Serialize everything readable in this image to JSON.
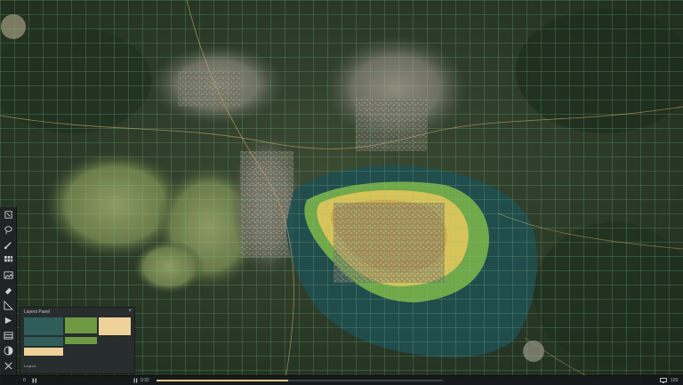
{
  "layers_panel": {
    "title": "Layers Panel",
    "close_glyph": "×",
    "swatches": [
      {
        "color": "#2f5e5a"
      },
      {
        "color": "#6f9a44"
      },
      {
        "color": "#efd19a"
      },
      {
        "color": "#2f5e5a"
      },
      {
        "color": "#6f9a44"
      },
      {
        "color": "#efd19a"
      }
    ],
    "footer_text": "Legend"
  },
  "toolbar": {
    "tools": [
      {
        "name": "select-tool-icon",
        "icon": "select"
      },
      {
        "name": "lasso-tool-icon",
        "icon": "lasso"
      },
      {
        "name": "brush-tool-icon",
        "icon": "brush"
      },
      {
        "name": "grid-tool-icon",
        "icon": "grid"
      },
      {
        "name": "image-tool-icon",
        "icon": "image"
      },
      {
        "name": "eraser-tool-icon",
        "icon": "eraser"
      },
      {
        "name": "ruler-tool-icon",
        "icon": "ruler"
      },
      {
        "name": "play-tool-icon",
        "icon": "play"
      },
      {
        "name": "layers-tool-icon",
        "icon": "layers"
      },
      {
        "name": "contrast-tool-icon",
        "icon": "contrast"
      },
      {
        "name": "crosshair-tool-icon",
        "icon": "crosshair"
      }
    ]
  },
  "bottom_bar": {
    "left_label": "0",
    "time_label": "0:32",
    "progress": 0.46,
    "zoom_label": "120"
  },
  "colors": {
    "accent": "#e6c88a",
    "overlay_teal": "#2f8a8a",
    "overlay_yellow": "#e9c85c",
    "overlay_green": "#7fb84a"
  }
}
